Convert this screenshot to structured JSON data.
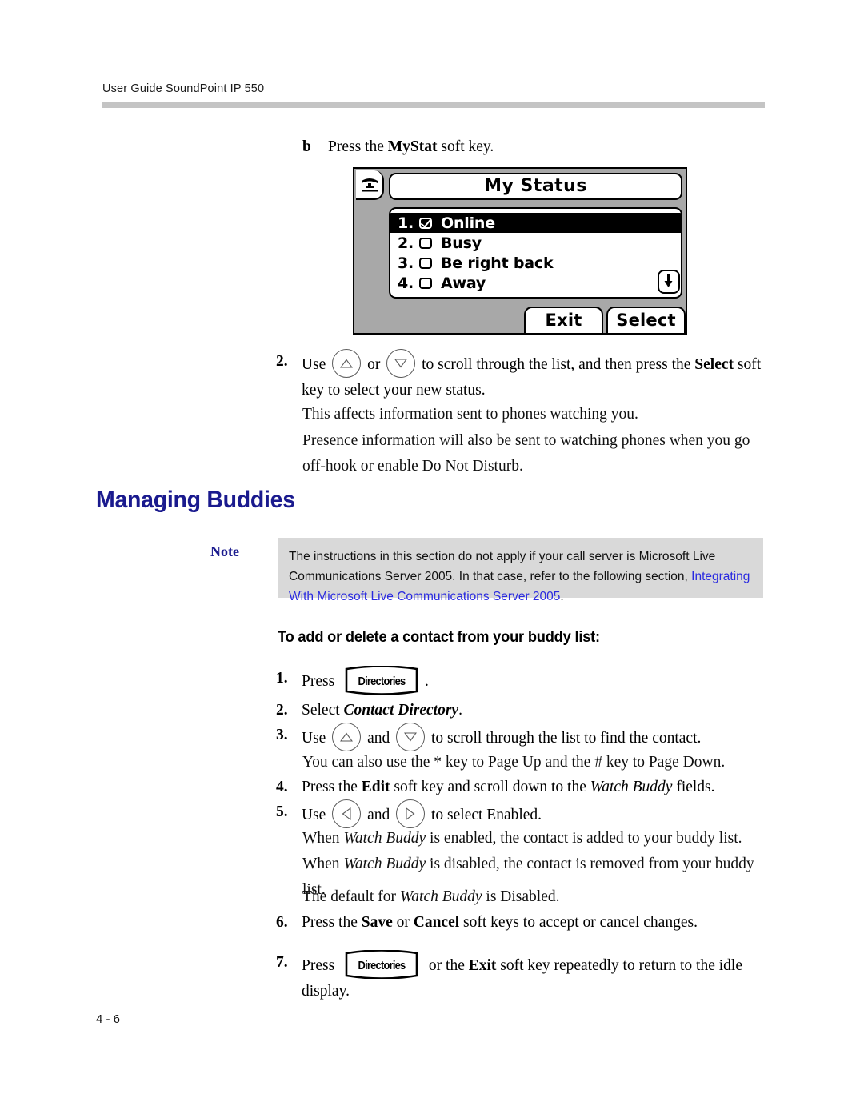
{
  "header": {
    "running_head": "User Guide SoundPoint IP 550"
  },
  "footer": {
    "page_number": "4 - 6"
  },
  "colors": {
    "heading_blue": "#1a1a8e",
    "link_blue": "#2a2ae0",
    "note_background": "#d9d9d9",
    "rule_gray": "#c4c4c4",
    "lcd_bezel_gray": "#a8a8a8"
  },
  "step_b": {
    "marker": "b",
    "text_before": "Press the ",
    "bold": "MyStat",
    "text_after": " soft key."
  },
  "phone_screen": {
    "title": "My Status",
    "phone_icon": "handset-icon",
    "scroll_indicator": "down-arrow-icon",
    "rows": [
      {
        "number": "1.",
        "label": "Online",
        "checked": true,
        "selected": true
      },
      {
        "number": "2.",
        "label": "Busy",
        "checked": false,
        "selected": false
      },
      {
        "number": "3.",
        "label": "Be right back",
        "checked": false,
        "selected": false
      },
      {
        "number": "4.",
        "label": "Away",
        "checked": false,
        "selected": false
      }
    ],
    "softkeys": [
      {
        "label": "Exit"
      },
      {
        "label": "Select"
      }
    ]
  },
  "step_2": {
    "marker": "2.",
    "part1": "Use ",
    "icon1": "up-arrow-key-icon",
    "part2": " or ",
    "icon2": "down-arrow-key-icon",
    "part3": " to scroll through the list, and then press the ",
    "bold": "Select",
    "part4": " soft key to select your new status.",
    "para1": "This affects information sent to phones watching you.",
    "para2": "Presence information will also be sent to watching phones when you go off-hook or enable Do Not Disturb."
  },
  "section": {
    "heading": "Managing Buddies"
  },
  "note": {
    "label": "Note",
    "text1": "The instructions in this section do not apply if your call server is Microsoft Live Communications Server 2005. In that case, refer to the following section, ",
    "link": "Integrating With Microsoft Live Communications Server 2005",
    "text2": "."
  },
  "procedure": {
    "heading": "To add or delete a contact from your buddy list:",
    "steps": [
      {
        "marker": "1.",
        "part1": "Press ",
        "key": "Directories",
        "part2": "."
      },
      {
        "marker": "2.",
        "part1": "Select ",
        "italic": "Contact Directory",
        "part2": "."
      },
      {
        "marker": "3.",
        "part1": "Use ",
        "icon1": "up-arrow-key-icon",
        "part2": " and ",
        "icon2": "down-arrow-key-icon",
        "part3": " to scroll through the list to find the contact.",
        "extra": "You can also use the * key to Page Up and the # key to Page Down."
      },
      {
        "marker": "4.",
        "part1": "Press the ",
        "bold": "Edit",
        "part2": " soft key and scroll down to the ",
        "italic": "Watch Buddy",
        "part3": " fields."
      },
      {
        "marker": "5.",
        "part1": "Use ",
        "icon1": "left-arrow-key-icon",
        "part2": " and ",
        "icon2": "right-arrow-key-icon",
        "part3": " to select Enabled.",
        "extra1_a": "When ",
        "extra1_i1": "Watch Buddy",
        "extra1_b": " is enabled, the contact is added to your buddy list. When ",
        "extra1_i2": "Watch Buddy",
        "extra1_c": " is disabled, the contact is removed from your buddy list.",
        "extra2_a": "The default for ",
        "extra2_i": "Watch Buddy",
        "extra2_b": " is Disabled."
      },
      {
        "marker": "6.",
        "part1": "Press the ",
        "bold1": "Save",
        "part2": " or ",
        "bold2": "Cancel",
        "part3": " soft keys to accept or cancel changes."
      },
      {
        "marker": "7.",
        "part1": "Press ",
        "key": "Directories",
        "part2": " or the ",
        "bold": "Exit",
        "part3": " soft key repeatedly to return to the idle display."
      }
    ]
  }
}
